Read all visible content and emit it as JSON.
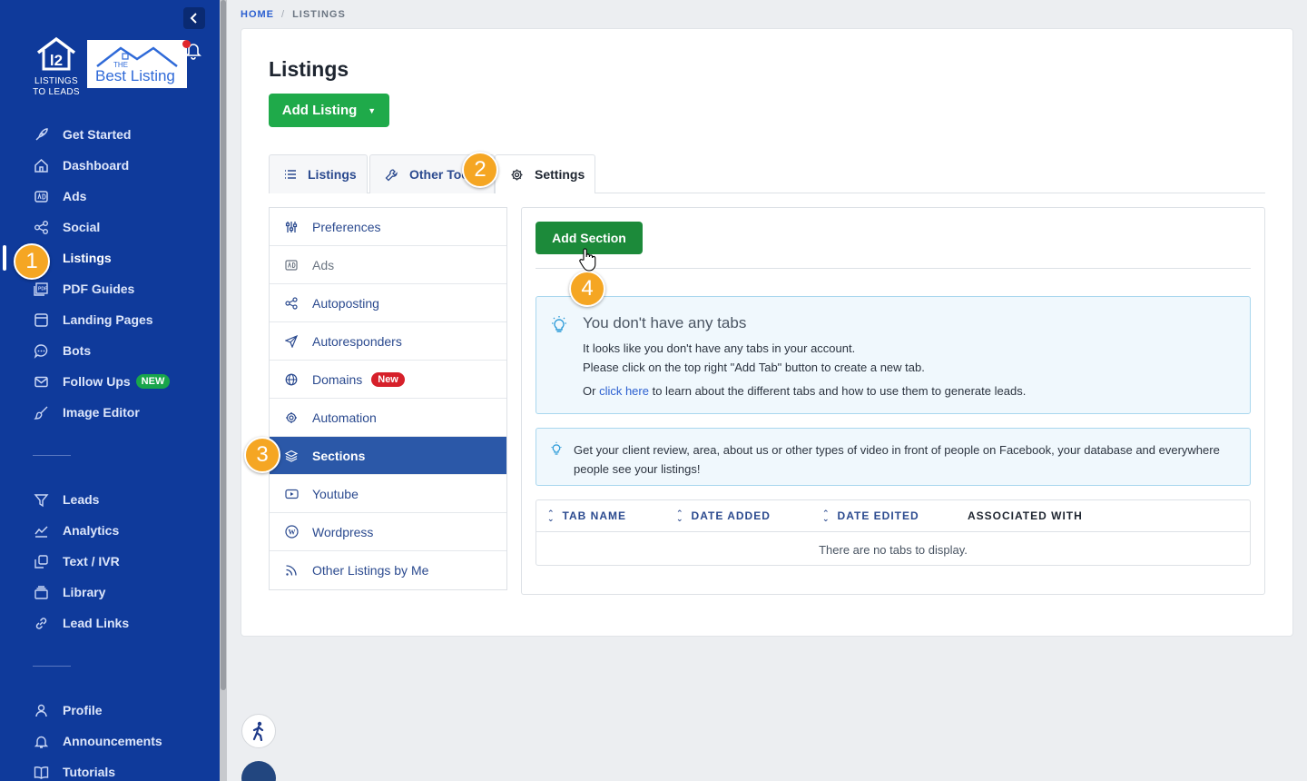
{
  "sidebar": {
    "logo_text_line1": "LISTINGS",
    "logo_text_line2": "TO LEADS",
    "brand_logo_small": "THE",
    "brand_logo_text": "Best Listing",
    "items": [
      {
        "label": "Get Started",
        "icon": "rocket-icon"
      },
      {
        "label": "Dashboard",
        "icon": "home-icon"
      },
      {
        "label": "Ads",
        "icon": "ad-icon"
      },
      {
        "label": "Social",
        "icon": "share-icon"
      },
      {
        "label": "Listings",
        "icon": "listings-icon"
      },
      {
        "label": "PDF Guides",
        "icon": "pdf-icon"
      },
      {
        "label": "Landing Pages",
        "icon": "page-icon"
      },
      {
        "label": "Bots",
        "icon": "chat-icon"
      },
      {
        "label": "Follow Ups",
        "icon": "mail-icon",
        "badge": "NEW"
      },
      {
        "label": "Image Editor",
        "icon": "brush-icon"
      }
    ],
    "items2": [
      {
        "label": "Leads",
        "icon": "filter-icon"
      },
      {
        "label": "Analytics",
        "icon": "chart-icon"
      },
      {
        "label": "Text / IVR",
        "icon": "phone-icon"
      },
      {
        "label": "Library",
        "icon": "folder-icon"
      },
      {
        "label": "Lead Links",
        "icon": "link-icon"
      }
    ],
    "items3": [
      {
        "label": "Profile",
        "icon": "user-icon"
      },
      {
        "label": "Announcements",
        "icon": "bell-icon"
      },
      {
        "label": "Tutorials",
        "icon": "book-icon"
      }
    ]
  },
  "breadcrumb": {
    "home": "HOME",
    "current": "LISTINGS"
  },
  "page": {
    "title": "Listings",
    "add_listing": "Add Listing"
  },
  "tabs": [
    {
      "label": "Listings"
    },
    {
      "label": "Other Tools"
    },
    {
      "label": "Settings"
    }
  ],
  "settings_menu": [
    {
      "label": "Preferences"
    },
    {
      "label": "Ads"
    },
    {
      "label": "Autoposting"
    },
    {
      "label": "Autoresponders"
    },
    {
      "label": "Domains",
      "badge": "New"
    },
    {
      "label": "Automation"
    },
    {
      "label": "Sections"
    },
    {
      "label": "Youtube"
    },
    {
      "label": "Wordpress"
    },
    {
      "label": "Other Listings by Me"
    }
  ],
  "panel": {
    "add_section": "Add Section",
    "info_title": "You don't have any tabs",
    "info_line1": "It looks like you don't have any tabs in your account.",
    "info_line2": "Please click on the top right \"Add Tab\" button to create a new tab.",
    "info_line3_pre": "Or ",
    "info_line3_link": "click here",
    "info_line3_post": " to learn about the different tabs and how to use them to generate leads.",
    "info2_text": "Get your client review, area, about us or other types of video in front of people on Facebook, your database and everywhere people see your listings!",
    "table_headers": [
      "TAB NAME",
      "DATE ADDED",
      "DATE EDITED",
      "ASSOCIATED WITH"
    ],
    "empty_text": "There are no tabs to display."
  },
  "steps": [
    "1",
    "2",
    "3",
    "4"
  ],
  "colors": {
    "sidebar_bg": "#0f3a9b",
    "primary_green": "#1faa4a",
    "active_menu": "#2b58a8",
    "step_marker": "#f5a623"
  }
}
